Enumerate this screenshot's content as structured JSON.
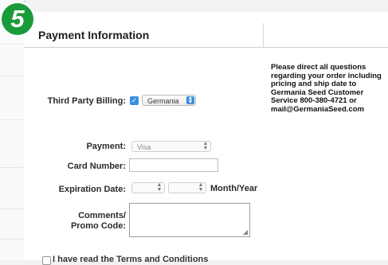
{
  "step_badge": "5",
  "section_title": "Payment Information",
  "note": "Please direct all questions regarding your order including pricing and ship date to Germania Seed Customer Service 800-380-4721 or mail@GermaniaSeed.com",
  "third_party_billing": {
    "label": "Third Party Billing:",
    "checked": true,
    "selected": "Germania"
  },
  "payment": {
    "label": "Payment:",
    "selected": "Visa"
  },
  "card_number": {
    "label": "Card Number:",
    "value": ""
  },
  "expiration": {
    "label": "Expiration Date:",
    "month_value": "",
    "year_value": "",
    "suffix": "Month/Year"
  },
  "comments": {
    "label_line1": "Comments/",
    "label_line2": "Promo Code:",
    "value": ""
  },
  "terms": {
    "label": "I have read the Terms and Conditions"
  },
  "icons": {
    "checkbox": "checkmark-icon",
    "select_arrows": "updown-arrows-icon",
    "resize": "resize-grip-icon"
  },
  "colors": {
    "badge": "#1a9b3a",
    "accent": "#3b8ee0"
  }
}
